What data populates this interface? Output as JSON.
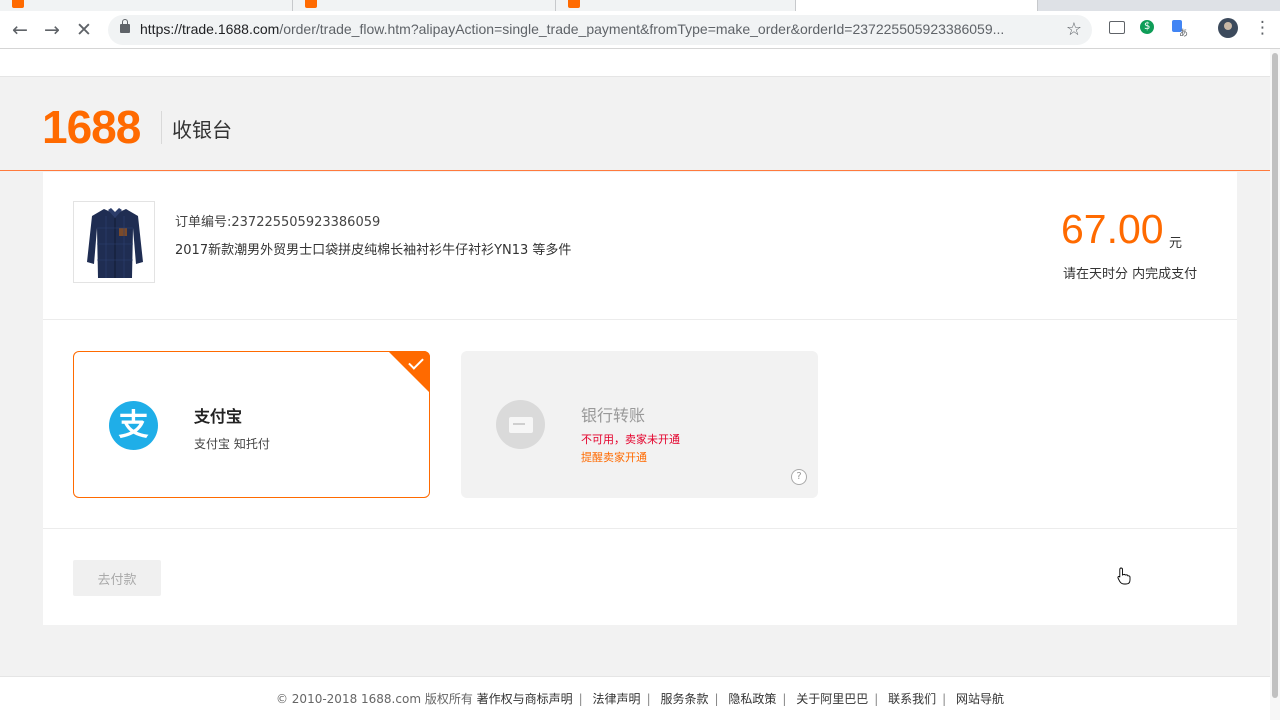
{
  "browser": {
    "url_host": "https://trade.1688.com",
    "url_path": "/order/trade_flow.htm?alipayAction=single_trade_payment&fromType=make_order&orderId=237225505923386059..."
  },
  "header": {
    "logo_text": "1688",
    "title": "收银台"
  },
  "order": {
    "order_number": "订单编号:237225505923386059",
    "product_title": "2017新款潮男外贸男士口袋拼皮纯棉长袖衬衫牛仔衬衫YN13  等多件",
    "amount": "67.00",
    "currency": "元",
    "deadline": "请在天时分 内完成支付"
  },
  "payment_methods": [
    {
      "name": "支付宝",
      "sub": "支付宝 知托付",
      "selected": true
    },
    {
      "name": "银行转账",
      "status": "不可用，卖家未开通",
      "remind": "提醒卖家开通",
      "help": "?",
      "selected": false
    }
  ],
  "actions": {
    "pay_label": "去付款"
  },
  "footer": {
    "copyright": "© 2010-2018 1688.com 版权所有",
    "links": [
      "著作权与商标声明",
      "法律声明",
      "服务条款",
      "隐私政策",
      "关于阿里巴巴",
      "联系我们",
      "网站导航"
    ]
  },
  "colors": {
    "brand": "#ff6a00",
    "alipay": "#1faee8",
    "error": "#e4002b"
  }
}
